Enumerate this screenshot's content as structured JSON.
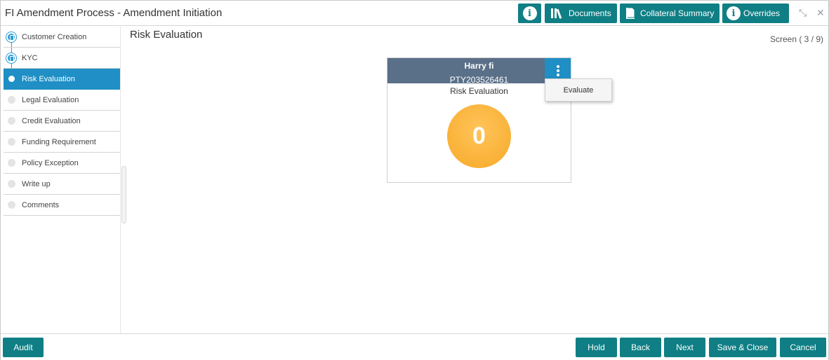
{
  "header": {
    "title": "FI Amendment Process - Amendment Initiation",
    "info_icon": "info-icon",
    "documents_label": "Documents",
    "collateral_label": "Collateral Summary",
    "overrides_label": "Overrides",
    "minimize_glyph": "⤡",
    "close_glyph": "✕"
  },
  "sidebar": {
    "items": [
      {
        "label": "Customer Creation",
        "state": "done"
      },
      {
        "label": "KYC",
        "state": "done"
      },
      {
        "label": "Risk Evaluation",
        "state": "active"
      },
      {
        "label": "Legal Evaluation",
        "state": "pending"
      },
      {
        "label": "Credit Evaluation",
        "state": "pending"
      },
      {
        "label": "Funding Requirement",
        "state": "pending"
      },
      {
        "label": "Policy Exception",
        "state": "pending"
      },
      {
        "label": "Write up",
        "state": "pending"
      },
      {
        "label": "Comments",
        "state": "pending"
      }
    ]
  },
  "main": {
    "title": "Risk Evaluation",
    "screen_counter": "Screen ( 3 / 9)",
    "card": {
      "name": "Harry fi",
      "party_id": "PTY203526461",
      "label": "Risk Evaluation",
      "score": "0"
    },
    "menu": {
      "evaluate_label": "Evaluate"
    }
  },
  "footer": {
    "audit_label": "Audit",
    "hold_label": "Hold",
    "back_label": "Back",
    "next_label": "Next",
    "save_close_label": "Save & Close",
    "cancel_label": "Cancel"
  },
  "colors": {
    "primary_button": "#0f7f85",
    "active_step": "#1f8fc5",
    "card_header": "#5a6f88",
    "score_circle": "#f7a928"
  }
}
